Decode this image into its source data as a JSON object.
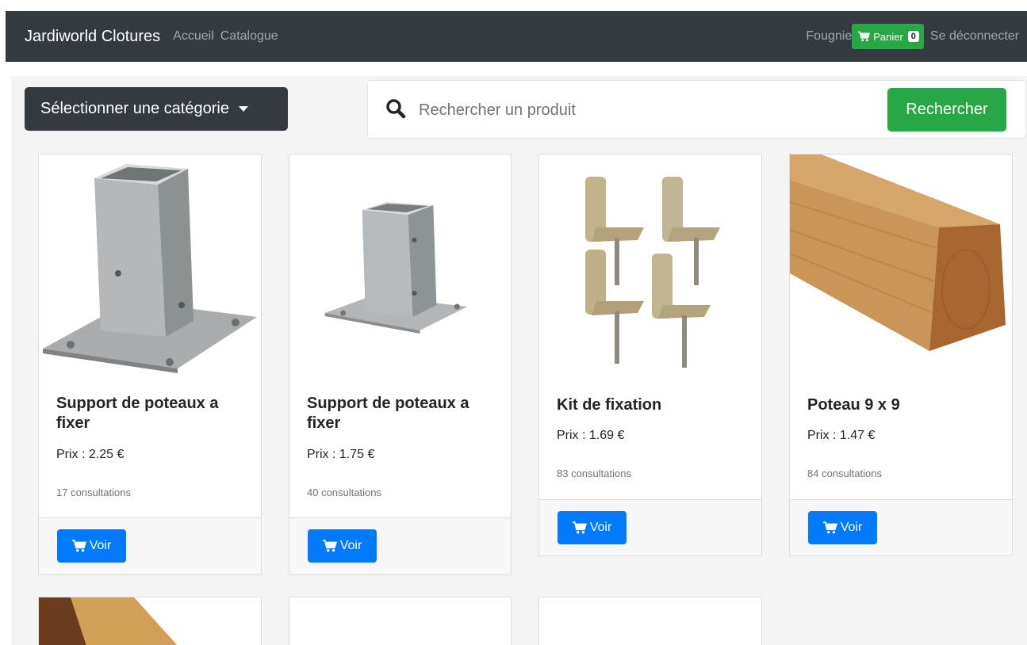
{
  "navbar": {
    "brand": "Jardiworld Clotures",
    "links": [
      "Accueil",
      "Catalogue"
    ],
    "user": "Fougnie",
    "cart_label": "Panier",
    "cart_count": "0",
    "logout": "Se déconnecter"
  },
  "filters": {
    "category_button": "Sélectionner une catégorie",
    "search_placeholder": "Rechercher un produit",
    "search_button": "Rechercher"
  },
  "products": [
    {
      "title": "Support de poteaux a fixer",
      "price": "Prix : 2.25 €",
      "views": "17 consultations",
      "button": "Voir",
      "image": "tall-galvanized-post-support"
    },
    {
      "title": "Support de poteaux a fixer",
      "price": "Prix : 1.75 €",
      "views": "40 consultations",
      "button": "Voir",
      "image": "small-galvanized-post-support"
    },
    {
      "title": "Kit de fixation",
      "price": "Prix : 1.69 €",
      "views": "83 consultations",
      "button": "Voir",
      "image": "fixing-brackets-kit"
    },
    {
      "title": "Poteau 9 x 9",
      "price": "Prix : 1.47 €",
      "views": "84 consultations",
      "button": "Voir",
      "image": "wooden-post"
    }
  ],
  "icons": {
    "cart": "cart-icon",
    "search": "search-icon",
    "dropdown": "caret-down-icon"
  },
  "colors": {
    "navbar": "#343a40",
    "success": "#28a745",
    "primary": "#007bff",
    "page_bg": "#f4f4f5"
  }
}
